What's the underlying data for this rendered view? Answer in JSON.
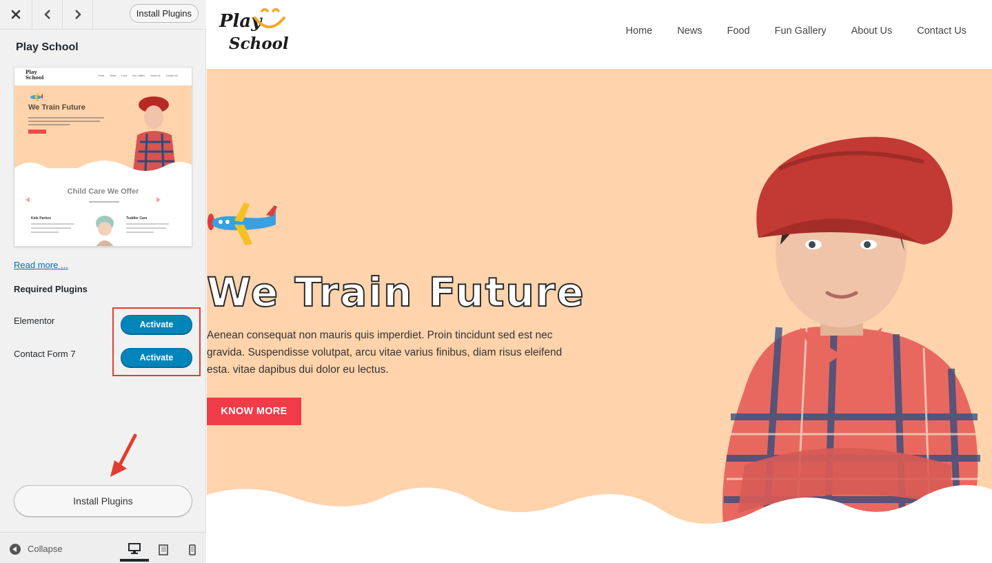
{
  "sidebar": {
    "topbar": {
      "close_icon": "close-icon",
      "prev_icon": "chevron-left-icon",
      "next_icon": "chevron-right-icon",
      "install_label": "Install Plugins"
    },
    "theme_name": "Play School",
    "screenshot": {
      "logo_line1": "Play",
      "logo_line2": "School",
      "nav": [
        "Home",
        "News",
        "Food",
        "Fun Gallery",
        "About Us",
        "Contact Us"
      ],
      "title": "We Train Future",
      "section_title": "Child Care We Offer",
      "col1": "Kids Parties",
      "col2": "Toddler Care"
    },
    "read_more": "Read more ...",
    "required_title": "Required Plugins",
    "plugins": [
      {
        "name": "Elementor",
        "action": "Activate"
      },
      {
        "name": "Contact Form 7",
        "action": "Activate"
      }
    ],
    "install_plugins_label": "Install Plugins",
    "footer": {
      "collapse_label": "Collapse",
      "devices": [
        "desktop",
        "tablet",
        "mobile"
      ],
      "active_device": "desktop"
    }
  },
  "site": {
    "logo_line1": "Play",
    "logo_line2": "School",
    "nav": [
      "Home",
      "News",
      "Food",
      "Fun Gallery",
      "About Us",
      "Contact Us"
    ],
    "hero": {
      "title": "We Train Future",
      "text": "Aenean consequat non mauris quis imperdiet. Proin tincidunt sed est nec gravida. Suspendisse volutpat, arcu vitae varius finibus, diam risus eleifend esta. vitae dapibus dui dolor eu lectus.",
      "button": "KNOW MORE"
    }
  },
  "colors": {
    "hero_bg": "#ffd3ab",
    "button_red": "#f03c48",
    "wp_blue": "#0085ba",
    "highlight_red": "#e53c2f"
  }
}
